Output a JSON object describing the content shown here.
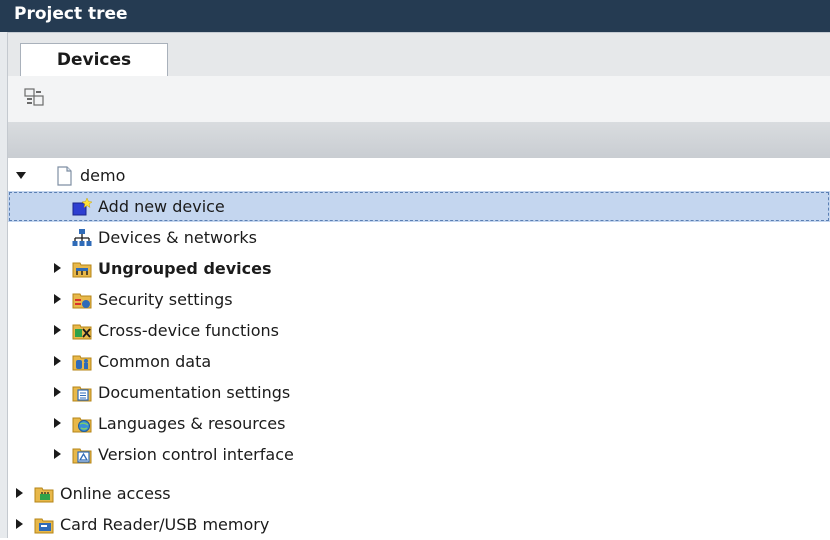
{
  "panel": {
    "title": "Project tree"
  },
  "tabs": [
    {
      "label": "Devices"
    }
  ],
  "toolbar": {
    "icons": [
      "device-view-icon"
    ]
  },
  "tree": {
    "project": {
      "label": "demo",
      "icon": "project-file-icon",
      "expanded": true
    },
    "children": [
      {
        "label": "Add new device",
        "icon": "add-device-icon",
        "selected": true
      },
      {
        "label": "Devices & networks",
        "icon": "network-icon"
      },
      {
        "label": "Ungrouped devices",
        "icon": "ungrouped-devices-icon",
        "bold": true
      },
      {
        "label": "Security settings",
        "icon": "security-settings-icon"
      },
      {
        "label": "Cross-device functions",
        "icon": "cross-device-icon"
      },
      {
        "label": "Common data",
        "icon": "common-data-icon"
      },
      {
        "label": "Documentation settings",
        "icon": "documentation-icon"
      },
      {
        "label": "Languages & resources",
        "icon": "languages-icon"
      },
      {
        "label": "Version control interface",
        "icon": "version-control-icon"
      }
    ],
    "root_items": [
      {
        "label": "Online access",
        "icon": "online-access-icon"
      },
      {
        "label": "Card Reader/USB memory",
        "icon": "card-reader-icon"
      }
    ]
  },
  "colors": {
    "titlebar": "#253b52",
    "selection": "#c4d6ef",
    "folder": "#e8b84a"
  }
}
